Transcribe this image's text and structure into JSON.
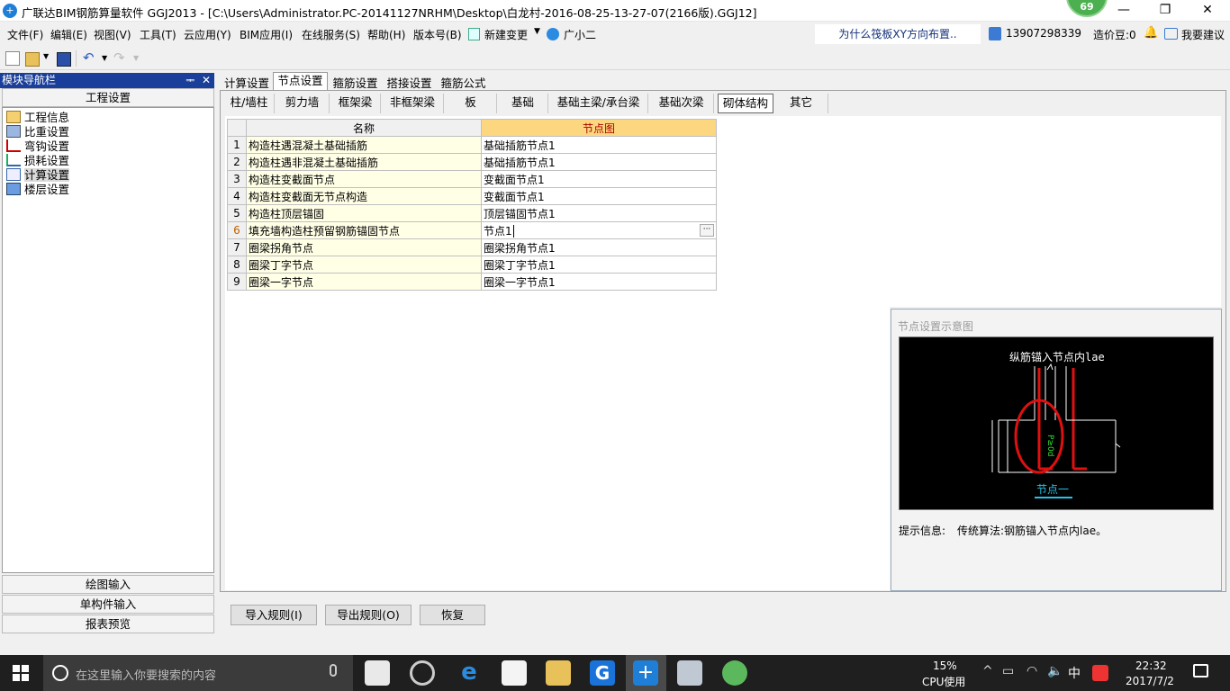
{
  "window": {
    "title": "广联达BIM钢筋算量软件 GGJ2013 - [C:\\Users\\Administrator.PC-20141127NRHM\\Desktop\\白龙村-2016-08-25-13-27-07(2166版).GGJ12]",
    "badge": "69",
    "minimize": "—",
    "maximize": "❐",
    "close": "✕"
  },
  "menu": {
    "items": [
      "文件(F)",
      "编辑(E)",
      "视图(V)",
      "工具(T)",
      "云应用(Y)",
      "BIM应用(I)",
      "在线服务(S)",
      "帮助(H)",
      "版本号(B)",
      "新建变更",
      "广小二"
    ],
    "help_link": "为什么筏板XY方向布置..",
    "phone": "13907298339",
    "cost_beans": "造价豆:0",
    "suggest": "我要建议"
  },
  "nav": {
    "header": "模块导航栏",
    "pin": "ᆍ",
    "close": "✕",
    "section_top": "工程设置",
    "items": [
      "工程信息",
      "比重设置",
      "弯钩设置",
      "损耗设置",
      "计算设置",
      "楼层设置"
    ],
    "section_bottom": [
      "绘图输入",
      "单构件输入",
      "报表预览"
    ]
  },
  "main_tabs": [
    "计算设置",
    "节点设置",
    "箍筋设置",
    "搭接设置",
    "箍筋公式"
  ],
  "sub_tabs": [
    "柱/墙柱",
    "剪力墙",
    "框架梁",
    "非框架梁",
    "板",
    "基础",
    "基础主梁/承台梁",
    "基础次梁",
    "砌体结构",
    "其它"
  ],
  "grid": {
    "col_name": "名称",
    "col_node": "节点图",
    "rows": [
      {
        "n": "1",
        "name": "构造柱遇混凝土基础插筋",
        "node": "基础插筋节点1"
      },
      {
        "n": "2",
        "name": "构造柱遇非混凝土基础插筋",
        "node": "基础插筋节点1"
      },
      {
        "n": "3",
        "name": "构造柱变截面节点",
        "node": "变截面节点1"
      },
      {
        "n": "4",
        "name": "构造柱变截面无节点构造",
        "node": "变截面节点1"
      },
      {
        "n": "5",
        "name": "构造柱顶层锚固",
        "node": "顶层锚固节点1"
      },
      {
        "n": "6",
        "name": "填充墙构造柱预留钢筋锚固节点",
        "node": "节点1"
      },
      {
        "n": "7",
        "name": "圈梁拐角节点",
        "node": "圈梁拐角节点1"
      },
      {
        "n": "8",
        "name": "圈梁丁字节点",
        "node": "圈梁丁字节点1"
      },
      {
        "n": "9",
        "name": "圈梁一字节点",
        "node": "圈梁一字节点1"
      }
    ],
    "ellipsis": "···"
  },
  "diagram": {
    "title": "节点设置示意图",
    "label_top": "纵筋锚入节点内lae",
    "label_side": "P≥0d",
    "label_bottom": "节点一",
    "hint_label": "提示信息:",
    "hint_text": "传统算法:钢筋锚入节点内lae。"
  },
  "buttons": {
    "import": "导入规则(I)",
    "export": "导出规则(O)",
    "restore": "恢复"
  },
  "taskbar": {
    "search_placeholder": "在这里输入你要搜索的内容",
    "cpu_percent": "15%",
    "cpu_label": "CPU使用",
    "ime": "中",
    "time": "22:32",
    "date": "2017/7/2"
  },
  "colors": {
    "nav_header": "#1a3f9a",
    "node_col_header": "#fdd77f",
    "name_cell": "#ffffe6",
    "diagram_bg": "#000000",
    "diagram_red": "#e01010"
  }
}
